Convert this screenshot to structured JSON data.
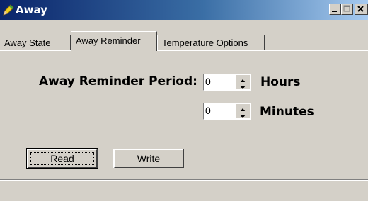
{
  "window": {
    "title": "Away"
  },
  "tabs": [
    {
      "label": "Away State"
    },
    {
      "label": "Away Reminder"
    },
    {
      "label": "Temperature Options"
    }
  ],
  "reminder": {
    "period_label": "Away Reminder Period:",
    "hours_value": "0",
    "hours_unit": "Hours",
    "minutes_value": "0",
    "minutes_unit": "Minutes"
  },
  "buttons": {
    "read": "Read",
    "write": "Write"
  }
}
